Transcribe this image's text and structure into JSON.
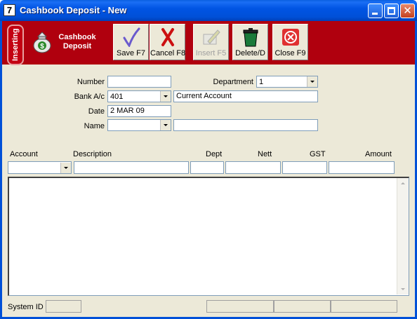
{
  "window": {
    "icon_text": "7",
    "title": "Cashbook Deposit - New"
  },
  "toolbar": {
    "mode": "Inserting",
    "module_title": "Cashbook Deposit",
    "buttons": [
      {
        "label": "Save F7",
        "icon": "checkmark-icon",
        "enabled": true
      },
      {
        "label": "Cancel F8",
        "icon": "red-x-icon",
        "enabled": true
      },
      {
        "label": "Insert F5",
        "icon": "insert-pencil-icon",
        "enabled": false
      },
      {
        "label": "Delete/D",
        "icon": "trash-bin-icon",
        "enabled": true
      },
      {
        "label": "Close F9",
        "icon": "close-circle-icon",
        "enabled": true
      }
    ]
  },
  "form": {
    "number_label": "Number",
    "number_value": "",
    "department_label": "Department",
    "department_value": "1",
    "bank_label": "Bank A/c",
    "bank_value": "401",
    "bank_name": "Current Account",
    "date_label": "Date",
    "date_value": "2 MAR 09",
    "name_label": "Name",
    "name_value": "",
    "name_detail": ""
  },
  "lines": {
    "columns": [
      "Account",
      "Description",
      "Dept",
      "Nett",
      "GST",
      "Amount"
    ]
  },
  "status": {
    "system_id_label": "System ID",
    "system_id_value": ""
  },
  "colors": {
    "toolbar_bg": "#b0000e",
    "titlebar": "#0054e3",
    "frame_bg": "#ece9d8"
  }
}
